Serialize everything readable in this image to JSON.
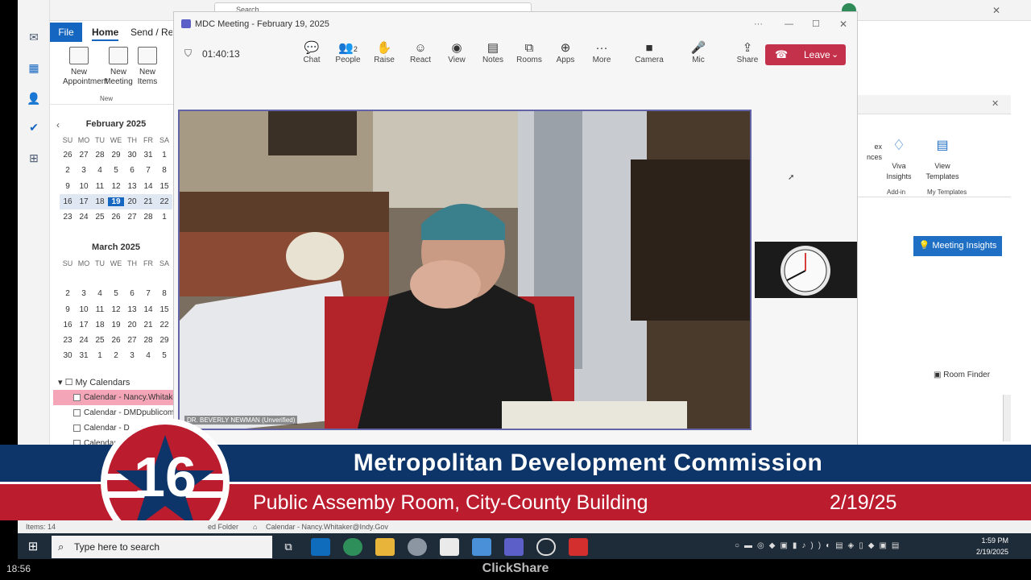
{
  "outlook": {
    "file_tab": "File",
    "home_tab": "Home",
    "send_tab": "Send / Re",
    "new_appointment": "New Appointment",
    "new_meeting": "New Meeting",
    "new_items": "New Items",
    "group_new": "New",
    "search_placeholder": "Search",
    "cal_feb": {
      "title": "February 2025",
      "rows": [
        [
          "26",
          "27",
          "28",
          "29",
          "30",
          "31",
          "1"
        ],
        [
          "2",
          "3",
          "4",
          "5",
          "6",
          "7",
          "8"
        ],
        [
          "9",
          "10",
          "11",
          "12",
          "13",
          "14",
          "15"
        ],
        [
          "16",
          "17",
          "18",
          "19",
          "20",
          "21",
          "22"
        ],
        [
          "23",
          "24",
          "25",
          "26",
          "27",
          "28",
          "1"
        ]
      ]
    },
    "cal_mar": {
      "title": "March 2025",
      "rows": [
        [
          "",
          "",
          "",
          "",
          "",
          "",
          ""
        ],
        [
          "2",
          "3",
          "4",
          "5",
          "6",
          "7",
          "8"
        ],
        [
          "9",
          "10",
          "11",
          "12",
          "13",
          "14",
          "15"
        ],
        [
          "16",
          "17",
          "18",
          "19",
          "20",
          "21",
          "22"
        ],
        [
          "23",
          "24",
          "25",
          "26",
          "27",
          "28",
          "29"
        ],
        [
          "30",
          "31",
          "1",
          "2",
          "3",
          "4",
          "5"
        ]
      ]
    },
    "dow": [
      "SU",
      "MO",
      "TU",
      "WE",
      "TH",
      "FR",
      "SA"
    ],
    "my_calendars": "My Calendars",
    "calendars": [
      "Calendar - Nancy.Whitaker",
      "Calendar - DMDpublicom",
      "Calendar - D",
      "Calendar"
    ],
    "status_items": "Items: 14",
    "status_folder": "ed Folder",
    "status_cal": "Calendar - Nancy.Whitaker@Indy.Gov",
    "viva_insights": "Viva Insights",
    "view_templates": "View Templates",
    "addin": "Add-in",
    "my_templates": "My Templates",
    "ex_frag": "ex nces",
    "meeting_insights": "Meeting Insights",
    "room_finder": "Room Finder"
  },
  "teams": {
    "title": "MDC Meeting - February 19, 2025",
    "timer": "01:40:13",
    "toolbar": [
      {
        "label": "Chat",
        "icon": "chat-icon"
      },
      {
        "label": "People",
        "icon": "people-icon",
        "badge": "2"
      },
      {
        "label": "Raise",
        "icon": "raise-hand-icon"
      },
      {
        "label": "React",
        "icon": "react-icon"
      },
      {
        "label": "View",
        "icon": "view-icon"
      },
      {
        "label": "Notes",
        "icon": "notes-icon"
      },
      {
        "label": "Rooms",
        "icon": "rooms-icon"
      },
      {
        "label": "Apps",
        "icon": "apps-icon"
      },
      {
        "label": "More",
        "icon": "more-icon"
      },
      {
        "label": "Camera",
        "icon": "camera-icon"
      },
      {
        "label": "Mic",
        "icon": "mic-icon"
      },
      {
        "label": "Share",
        "icon": "share-icon"
      }
    ],
    "leave": "Leave",
    "participant": "DR. BEVERLY NEWMAN (Unverified)"
  },
  "banner": {
    "channel": "16",
    "title": "Metropolitan Development Commission",
    "subtitle": "Public Assemby Room, City-County Building",
    "date": "2/19/25"
  },
  "taskbar": {
    "search": "Type here to search",
    "time": "1:59 PM",
    "date": "2/19/2025"
  },
  "footer": {
    "time": "18:56",
    "brand": "ClickShare"
  },
  "colors": {
    "banner_blue": "#0e3569",
    "banner_red": "#bb1c2e",
    "teams_accent": "#6264a7",
    "leave_red": "#c4314b"
  }
}
